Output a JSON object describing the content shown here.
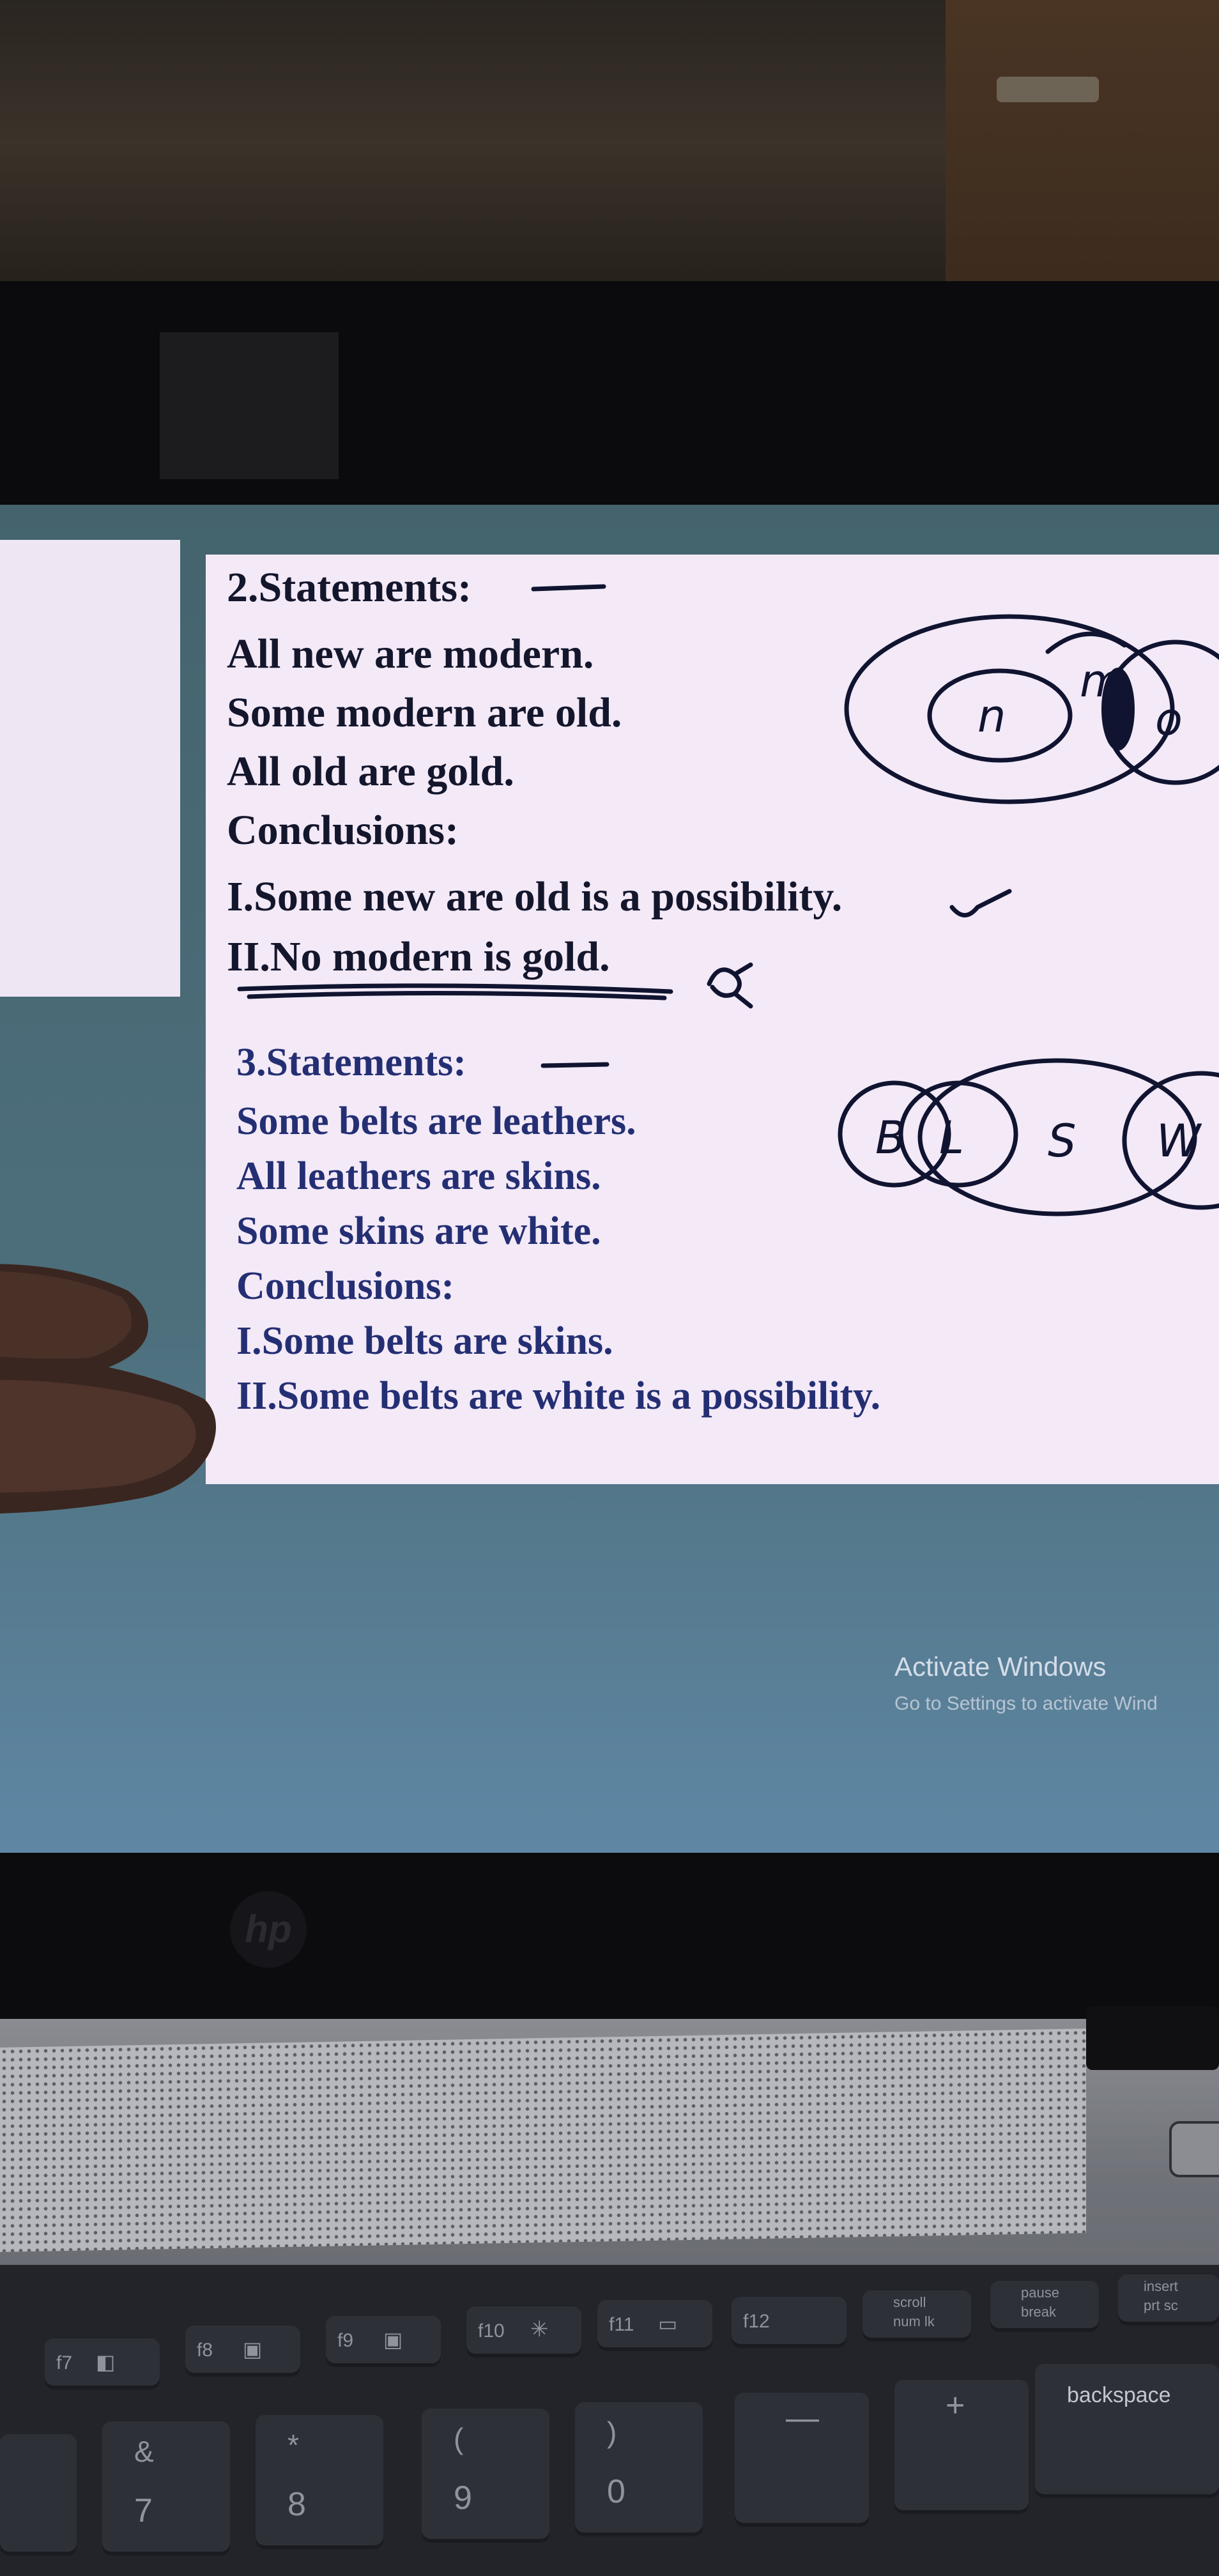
{
  "slide": {
    "question2": {
      "title": "2.Statements:",
      "statements": [
        "All new are modern.",
        "Some modern are old.",
        "All old are gold."
      ],
      "conclusions_label": "Conclusions:",
      "conclusions": [
        "I.Some new are old is a possibility.",
        "II.No modern is gold."
      ]
    },
    "question3": {
      "title": "3.Statements:",
      "statements": [
        "Some belts are leathers.",
        "All leathers are skins.",
        "Some skins are white."
      ],
      "conclusions_label": "Conclusions:",
      "conclusions": [
        "I.Some belts are skins.",
        "II.Some belts are white is a possibility."
      ]
    }
  },
  "handwriting": {
    "q2_circles": [
      "n",
      "m",
      "o"
    ],
    "q3_circles": [
      "B",
      "L",
      "S",
      "W"
    ]
  },
  "activate_windows": {
    "title": "Activate Windows",
    "subtitle": "Go to Settings to activate Wind"
  },
  "laptop": {
    "logo": "hp",
    "function_keys": [
      "f7",
      "f8",
      "f9",
      "f10",
      "f11",
      "f12"
    ],
    "scroll_key": [
      "scroll",
      "num lk"
    ],
    "pause_key": [
      "pause",
      "break"
    ],
    "insert_key": [
      "insert",
      "prt sc"
    ],
    "number_keys": [
      {
        "top": "&",
        "bottom": "7"
      },
      {
        "top": "*",
        "bottom": "8"
      },
      {
        "top": "(",
        "bottom": "9"
      },
      {
        "top": ")",
        "bottom": "0"
      }
    ],
    "backspace_label": "backspace"
  }
}
